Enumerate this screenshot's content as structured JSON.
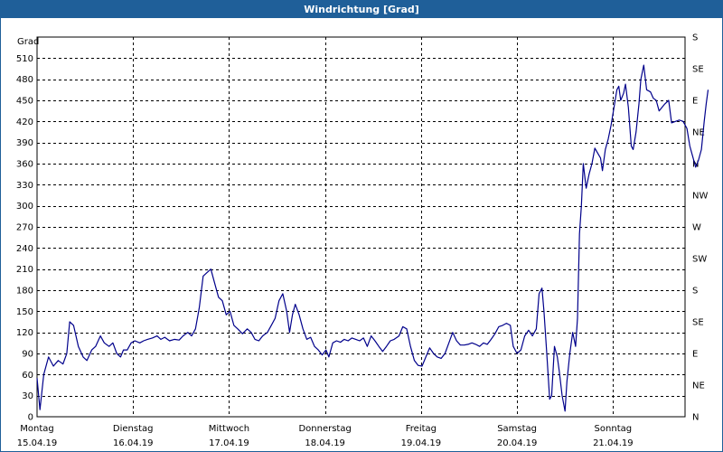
{
  "window": {
    "title": "Windrichtung [Grad]"
  },
  "colors": {
    "titlebar": "#1f5f99",
    "series": "#00008b",
    "grid": "#000000",
    "frame": "#000000"
  },
  "chart_data": {
    "type": "line",
    "title": "Windrichtung [Grad]",
    "ylabel": "Grad",
    "ylim": [
      0,
      540
    ],
    "yticks": [
      0,
      30,
      60,
      90,
      120,
      150,
      180,
      210,
      240,
      270,
      300,
      330,
      360,
      390,
      420,
      450,
      480,
      510
    ],
    "right_axis_labels": [
      "N",
      "NE",
      "E",
      "SE",
      "S",
      "SW",
      "W",
      "NW",
      "N",
      "NE",
      "E",
      "SE",
      "S"
    ],
    "xlim": [
      0,
      6.75
    ],
    "x_categories": [
      {
        "day": "Montag",
        "date": "15.04.19"
      },
      {
        "day": "Dienstag",
        "date": "16.04.19"
      },
      {
        "day": "Mittwoch",
        "date": "17.04.19"
      },
      {
        "day": "Donnerstag",
        "date": "18.04.19"
      },
      {
        "day": "Freitag",
        "date": "19.04.19"
      },
      {
        "day": "Samstag",
        "date": "20.04.19"
      },
      {
        "day": "Sonntag",
        "date": "21.04.19"
      }
    ],
    "grid": true,
    "series": [
      {
        "points": [
          [
            0.0,
            55
          ],
          [
            0.03,
            10
          ],
          [
            0.07,
            60
          ],
          [
            0.12,
            85
          ],
          [
            0.17,
            72
          ],
          [
            0.22,
            80
          ],
          [
            0.27,
            75
          ],
          [
            0.31,
            90
          ],
          [
            0.34,
            135
          ],
          [
            0.38,
            130
          ],
          [
            0.43,
            100
          ],
          [
            0.48,
            85
          ],
          [
            0.52,
            80
          ],
          [
            0.57,
            95
          ],
          [
            0.61,
            100
          ],
          [
            0.66,
            115
          ],
          [
            0.7,
            105
          ],
          [
            0.75,
            100
          ],
          [
            0.79,
            105
          ],
          [
            0.83,
            90
          ],
          [
            0.87,
            85
          ],
          [
            0.9,
            95
          ],
          [
            0.94,
            95
          ],
          [
            0.98,
            105
          ],
          [
            1.02,
            108
          ],
          [
            1.07,
            105
          ],
          [
            1.11,
            108
          ],
          [
            1.15,
            110
          ],
          [
            1.2,
            112
          ],
          [
            1.25,
            115
          ],
          [
            1.29,
            110
          ],
          [
            1.33,
            113
          ],
          [
            1.38,
            108
          ],
          [
            1.43,
            110
          ],
          [
            1.48,
            109
          ],
          [
            1.52,
            115
          ],
          [
            1.57,
            120
          ],
          [
            1.61,
            115
          ],
          [
            1.65,
            125
          ],
          [
            1.69,
            155
          ],
          [
            1.73,
            200
          ],
          [
            1.77,
            205
          ],
          [
            1.81,
            210
          ],
          [
            1.85,
            190
          ],
          [
            1.89,
            170
          ],
          [
            1.93,
            165
          ],
          [
            1.97,
            145
          ],
          [
            2.01,
            150
          ],
          [
            2.05,
            130
          ],
          [
            2.09,
            125
          ],
          [
            2.14,
            118
          ],
          [
            2.19,
            125
          ],
          [
            2.23,
            120
          ],
          [
            2.27,
            110
          ],
          [
            2.31,
            108
          ],
          [
            2.35,
            115
          ],
          [
            2.4,
            120
          ],
          [
            2.44,
            130
          ],
          [
            2.48,
            140
          ],
          [
            2.52,
            165
          ],
          [
            2.56,
            175
          ],
          [
            2.6,
            150
          ],
          [
            2.63,
            120
          ],
          [
            2.66,
            145
          ],
          [
            2.69,
            160
          ],
          [
            2.73,
            145
          ],
          [
            2.77,
            125
          ],
          [
            2.81,
            110
          ],
          [
            2.85,
            113
          ],
          [
            2.89,
            100
          ],
          [
            2.93,
            95
          ],
          [
            2.97,
            88
          ],
          [
            3.01,
            95
          ],
          [
            3.04,
            85
          ],
          [
            3.08,
            105
          ],
          [
            3.12,
            108
          ],
          [
            3.16,
            106
          ],
          [
            3.2,
            110
          ],
          [
            3.24,
            108
          ],
          [
            3.28,
            112
          ],
          [
            3.32,
            110
          ],
          [
            3.36,
            108
          ],
          [
            3.4,
            112
          ],
          [
            3.44,
            100
          ],
          [
            3.48,
            115
          ],
          [
            3.52,
            108
          ],
          [
            3.56,
            100
          ],
          [
            3.6,
            93
          ],
          [
            3.64,
            100
          ],
          [
            3.68,
            108
          ],
          [
            3.72,
            110
          ],
          [
            3.77,
            115
          ],
          [
            3.81,
            128
          ],
          [
            3.85,
            125
          ],
          [
            3.89,
            100
          ],
          [
            3.93,
            80
          ],
          [
            3.97,
            73
          ],
          [
            4.01,
            72
          ],
          [
            4.05,
            85
          ],
          [
            4.09,
            98
          ],
          [
            4.13,
            90
          ],
          [
            4.17,
            85
          ],
          [
            4.21,
            83
          ],
          [
            4.25,
            90
          ],
          [
            4.29,
            105
          ],
          [
            4.33,
            120
          ],
          [
            4.37,
            108
          ],
          [
            4.41,
            102
          ],
          [
            4.45,
            102
          ],
          [
            4.49,
            103
          ],
          [
            4.53,
            105
          ],
          [
            4.57,
            103
          ],
          [
            4.61,
            100
          ],
          [
            4.65,
            105
          ],
          [
            4.69,
            103
          ],
          [
            4.73,
            110
          ],
          [
            4.77,
            118
          ],
          [
            4.81,
            128
          ],
          [
            4.85,
            130
          ],
          [
            4.89,
            133
          ],
          [
            4.93,
            130
          ],
          [
            4.96,
            100
          ],
          [
            5.0,
            90
          ],
          [
            5.04,
            95
          ],
          [
            5.08,
            115
          ],
          [
            5.12,
            123
          ],
          [
            5.16,
            115
          ],
          [
            5.2,
            125
          ],
          [
            5.23,
            175
          ],
          [
            5.26,
            183
          ],
          [
            5.28,
            150
          ],
          [
            5.31,
            90
          ],
          [
            5.34,
            25
          ],
          [
            5.36,
            30
          ],
          [
            5.39,
            100
          ],
          [
            5.42,
            85
          ],
          [
            5.44,
            65
          ],
          [
            5.47,
            30
          ],
          [
            5.5,
            8
          ],
          [
            5.52,
            50
          ],
          [
            5.55,
            90
          ],
          [
            5.58,
            120
          ],
          [
            5.61,
            100
          ],
          [
            5.63,
            140
          ],
          [
            5.65,
            260
          ],
          [
            5.67,
            300
          ],
          [
            5.69,
            360
          ],
          [
            5.72,
            325
          ],
          [
            5.75,
            345
          ],
          [
            5.78,
            360
          ],
          [
            5.81,
            382
          ],
          [
            5.84,
            375
          ],
          [
            5.87,
            368
          ],
          [
            5.89,
            350
          ],
          [
            5.92,
            380
          ],
          [
            5.95,
            395
          ],
          [
            5.98,
            415
          ],
          [
            6.01,
            440
          ],
          [
            6.04,
            465
          ],
          [
            6.06,
            470
          ],
          [
            6.08,
            450
          ],
          [
            6.11,
            460
          ],
          [
            6.13,
            473
          ],
          [
            6.16,
            440
          ],
          [
            6.19,
            385
          ],
          [
            6.21,
            380
          ],
          [
            6.24,
            405
          ],
          [
            6.27,
            445
          ],
          [
            6.29,
            480
          ],
          [
            6.32,
            500
          ],
          [
            6.35,
            465
          ],
          [
            6.39,
            462
          ],
          [
            6.42,
            453
          ],
          [
            6.45,
            450
          ],
          [
            6.48,
            435
          ],
          [
            6.51,
            440
          ],
          [
            6.54,
            445
          ],
          [
            6.58,
            450
          ],
          [
            6.61,
            418
          ],
          [
            6.65,
            420
          ],
          [
            6.69,
            422
          ],
          [
            6.73,
            420
          ],
          [
            6.77,
            410
          ],
          [
            6.8,
            385
          ],
          [
            6.83,
            370
          ],
          [
            6.86,
            355
          ],
          [
            6.89,
            365
          ],
          [
            6.92,
            380
          ],
          [
            6.95,
            420
          ],
          [
            6.97,
            445
          ],
          [
            6.99,
            465
          ]
        ]
      }
    ]
  }
}
